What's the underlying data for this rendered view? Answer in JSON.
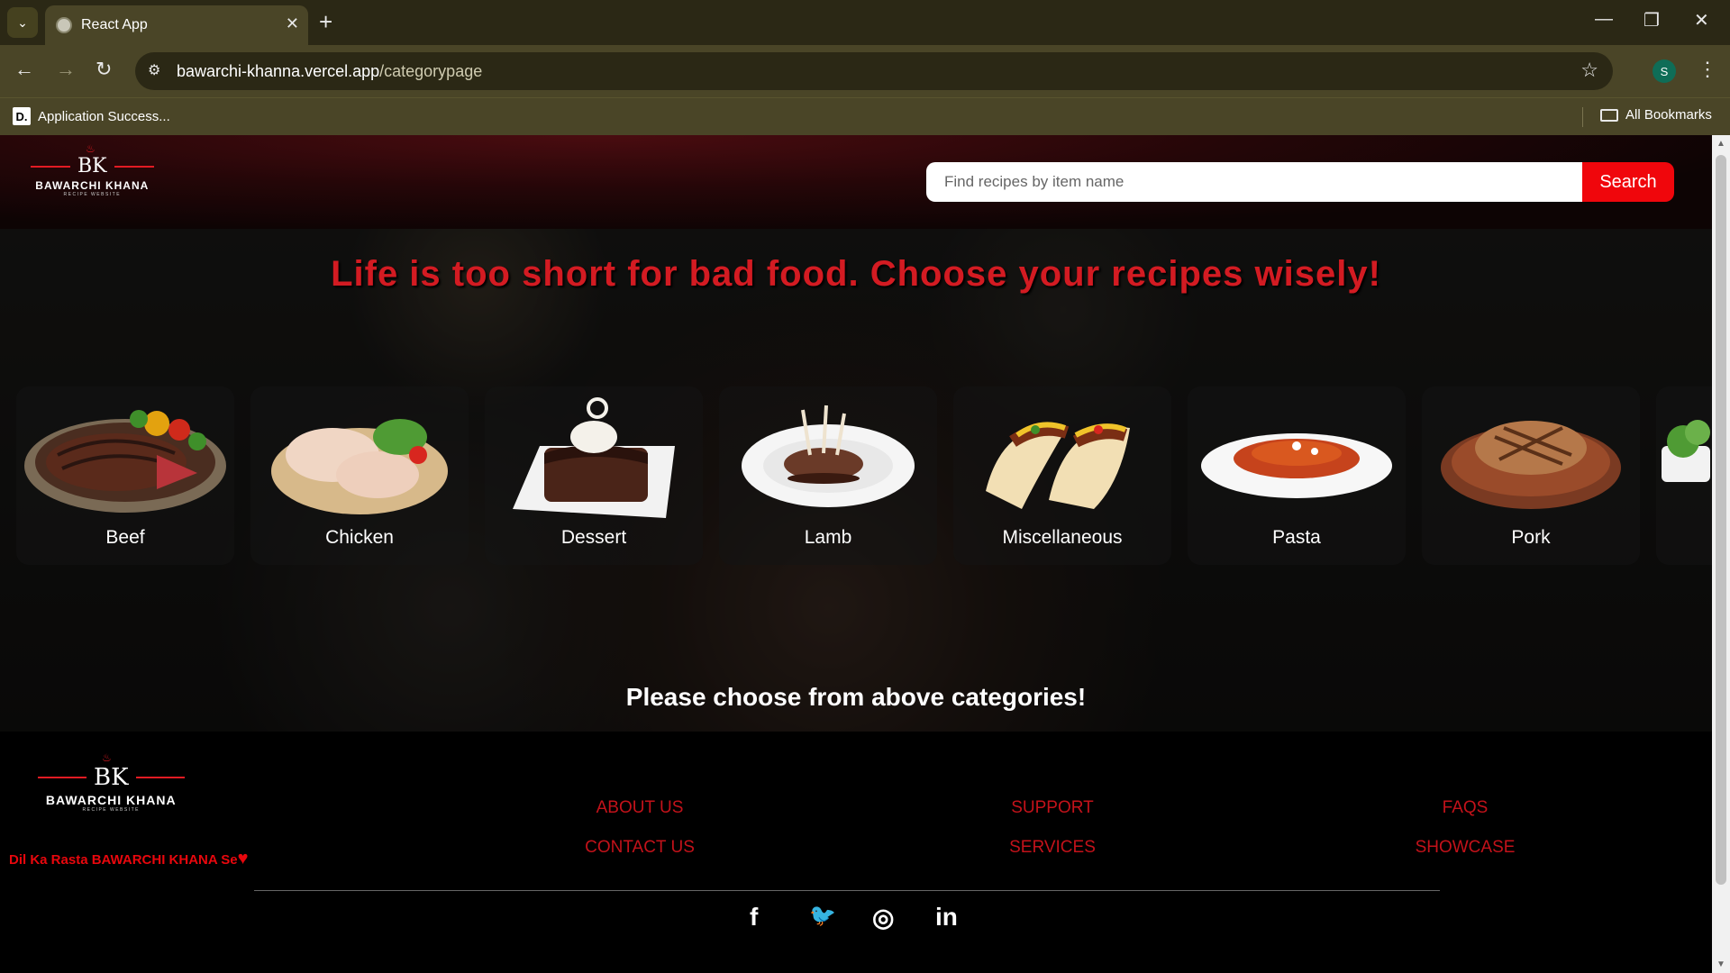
{
  "browser": {
    "tab_title": "React App",
    "url_host": "bawarchi-khanna.vercel.app",
    "url_path": "/categorypage",
    "profile_initial": "S",
    "bookmark_label": "Application Success...",
    "bookmark_favicon": "D.",
    "all_bookmarks": "All Bookmarks"
  },
  "header": {
    "logo_mark": "BK",
    "logo_name": "BAWARCHI KHANA",
    "logo_sub": "RECIPE WEBSITE",
    "search_placeholder": "Find recipes by item name",
    "search_button": "Search"
  },
  "hero": {
    "tagline": "Life is too short for bad food. Choose your recipes wisely!",
    "categories": [
      {
        "label": "Beef"
      },
      {
        "label": "Chicken"
      },
      {
        "label": "Dessert"
      },
      {
        "label": "Lamb"
      },
      {
        "label": "Miscellaneous"
      },
      {
        "label": "Pasta"
      },
      {
        "label": "Pork"
      },
      {
        "label": ""
      }
    ],
    "choose_message": "Please choose from above categories!"
  },
  "footer": {
    "tagline": "Dil Ka Rasta BAWARCHI KHANA Se",
    "links": {
      "about": "ABOUT US",
      "contact": "CONTACT US",
      "support": "SUPPORT",
      "services": "SERVICES",
      "faqs": "FAQS",
      "showcase": "SHOWCASE"
    },
    "social": {
      "facebook": "f",
      "twitter": "🐦",
      "instagram": "◎",
      "linkedin": "in"
    }
  },
  "colors": {
    "brand_red": "#f0060c",
    "tagline_red": "#d31b22",
    "footer_link": "#c3121a"
  }
}
